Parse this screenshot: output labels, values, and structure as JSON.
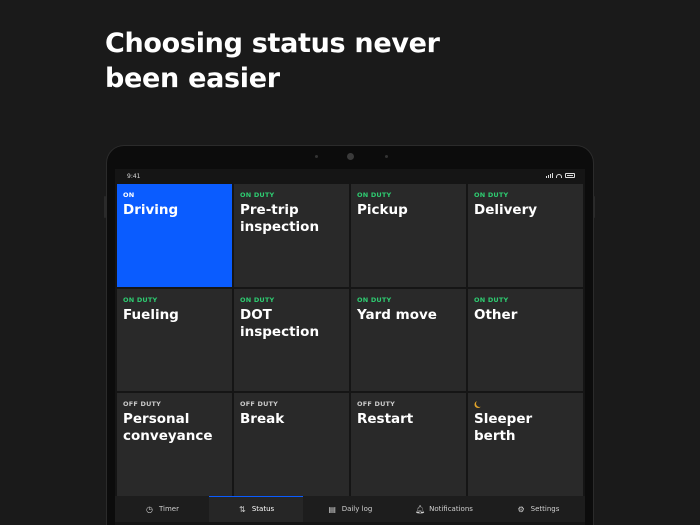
{
  "headline": {
    "line1": "Choosing status never",
    "line2": "been easier"
  },
  "statusbar": {
    "time": "9:41",
    "icons": [
      "signal-icon",
      "wifi-icon",
      "battery-icon"
    ]
  },
  "tiles": [
    {
      "tag": "ON",
      "label": "Driving",
      "kind": "on",
      "active": true
    },
    {
      "tag": "ON DUTY",
      "label": "Pre-trip inspection",
      "kind": "onduty"
    },
    {
      "tag": "ON DUTY",
      "label": "Pickup",
      "kind": "onduty"
    },
    {
      "tag": "ON DUTY",
      "label": "Delivery",
      "kind": "onduty"
    },
    {
      "tag": "ON DUTY",
      "label": "Fueling",
      "kind": "onduty"
    },
    {
      "tag": "ON DUTY",
      "label": "DOT inspection",
      "kind": "onduty"
    },
    {
      "tag": "ON DUTY",
      "label": "Yard move",
      "kind": "onduty"
    },
    {
      "tag": "ON DUTY",
      "label": "Other",
      "kind": "onduty"
    },
    {
      "tag": "OFF DUTY",
      "label": "Personal conveyance",
      "kind": "offduty"
    },
    {
      "tag": "OFF DUTY",
      "label": "Break",
      "kind": "offduty"
    },
    {
      "tag": "OFF DUTY",
      "label": "Restart",
      "kind": "offduty"
    },
    {
      "tag": "",
      "label": "Sleeper berth",
      "kind": "sleeper",
      "icon": "moon-icon"
    }
  ],
  "tabs": [
    {
      "label": "Timer",
      "icon": "timer-icon",
      "glyph": "◷"
    },
    {
      "label": "Status",
      "icon": "swap-icon",
      "glyph": "⇅",
      "active": true
    },
    {
      "label": "Daily log",
      "icon": "log-chart-icon",
      "glyph": "▤"
    },
    {
      "label": "Notifications",
      "icon": "bell-icon",
      "glyph": "♫"
    },
    {
      "label": "Settings",
      "icon": "gear-icon",
      "glyph": "⚙"
    }
  ],
  "colors": {
    "active_tile": "#0a5cff",
    "on_duty": "#2ecc71",
    "off_duty": "#c9c9c9",
    "sleeper_icon": "#e3a52b",
    "tile_bg": "#292929"
  }
}
